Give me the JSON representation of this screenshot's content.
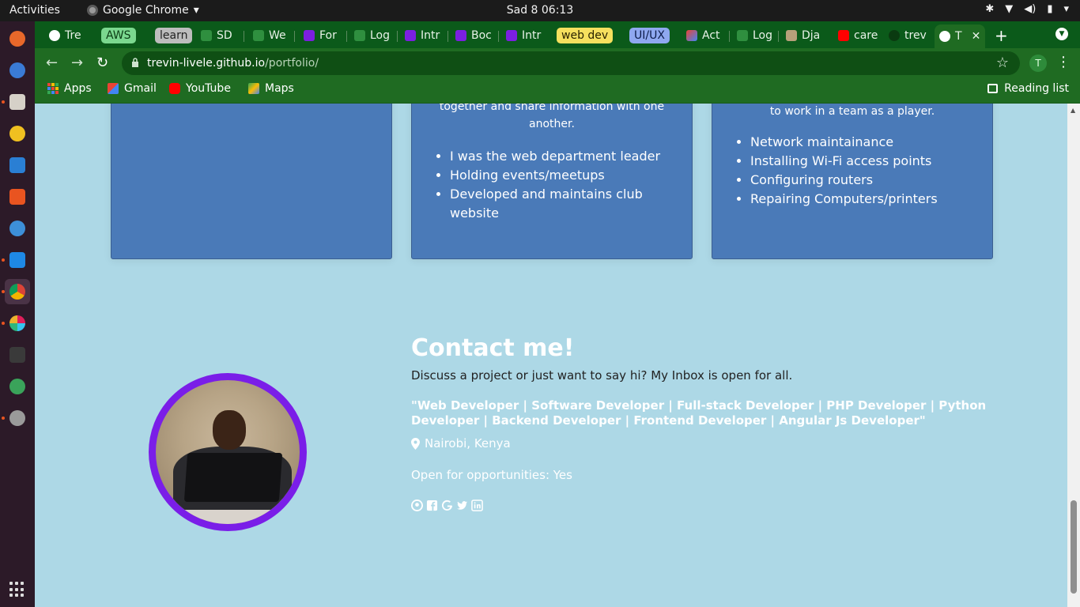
{
  "system": {
    "activities": "Activities",
    "app_name": "Google Chrome",
    "clock": "Sad 8  06:13"
  },
  "tabs": [
    {
      "label": "Tre",
      "kind": "page",
      "favicon": "globe-icon"
    },
    {
      "label": "AWS",
      "kind": "group",
      "color": "#7bd88f"
    },
    {
      "label": "learn",
      "kind": "group",
      "color": "#bdbdbd"
    },
    {
      "label": "SD",
      "kind": "page",
      "favicon": "tree-icon"
    },
    {
      "label": "We",
      "kind": "page",
      "favicon": "tree-icon"
    },
    {
      "label": "For",
      "kind": "page",
      "favicon": "bootstrap-icon"
    },
    {
      "label": "Log",
      "kind": "page",
      "favicon": "tree-icon"
    },
    {
      "label": "Intr",
      "kind": "page",
      "favicon": "bootstrap-icon"
    },
    {
      "label": "Boc",
      "kind": "page",
      "favicon": "bootstrap-icon"
    },
    {
      "label": "Intr",
      "kind": "page",
      "favicon": "bootstrap-icon"
    },
    {
      "label": "web dev",
      "kind": "group",
      "color": "#f6e05e"
    },
    {
      "label": "UI/UX",
      "kind": "group",
      "color": "#8fa8f0"
    },
    {
      "label": "Act",
      "kind": "page",
      "favicon": "gmail-icon"
    },
    {
      "label": "Log",
      "kind": "page",
      "favicon": "tree-icon"
    },
    {
      "label": "Dja",
      "kind": "page",
      "favicon": "image-icon"
    },
    {
      "label": "care",
      "kind": "page",
      "favicon": "youtube-icon"
    },
    {
      "label": "trev",
      "kind": "page",
      "favicon": "github-icon"
    },
    {
      "label": "T",
      "kind": "current",
      "favicon": "globe-icon"
    }
  ],
  "toolbar": {
    "url_host": "trevin-livele.github.io",
    "url_path": "/portfolio/",
    "profile_initial": "T"
  },
  "bookmarks": {
    "items": [
      {
        "label": "Apps",
        "icon": "apps-grid-icon"
      },
      {
        "label": "Gmail",
        "icon": "gmail-icon"
      },
      {
        "label": "YouTube",
        "icon": "youtube-icon"
      },
      {
        "label": "Maps",
        "icon": "maps-icon"
      }
    ],
    "reading_list": "Reading list"
  },
  "cards": [
    {
      "para": [],
      "bullets": []
    },
    {
      "para": [
        "together and share information with one",
        "another."
      ],
      "bullets": [
        "I was the web department leader",
        "Holding events/meetups",
        "Developed and maintains club website"
      ]
    },
    {
      "para": [
        "to work in a team as a player."
      ],
      "bullets": [
        "Network maintainance",
        "Installing Wi-Fi access points",
        "Configuring routers",
        "Repairing Computers/printers"
      ]
    }
  ],
  "contact": {
    "title": "Contact me!",
    "lead": "Discuss a project or just want to say hi? My Inbox is open for all.",
    "roles": "\"Web Developer | Software Developer | Full-stack Developer | PHP Developer | Python Developer | Backend Developer | Frontend Developer | Angular Js Developer\"",
    "location": "Nairobi, Kenya",
    "open": "Open for opportunities: Yes",
    "socials": [
      "github-icon",
      "facebook-icon",
      "google-icon",
      "twitter-icon",
      "linkedin-icon"
    ]
  },
  "colors": {
    "page_bg": "#add8e6",
    "card_bg": "#4a7ab8",
    "avatar_ring": "#7a1ee8",
    "chrome_frame": "#1f6b22"
  }
}
